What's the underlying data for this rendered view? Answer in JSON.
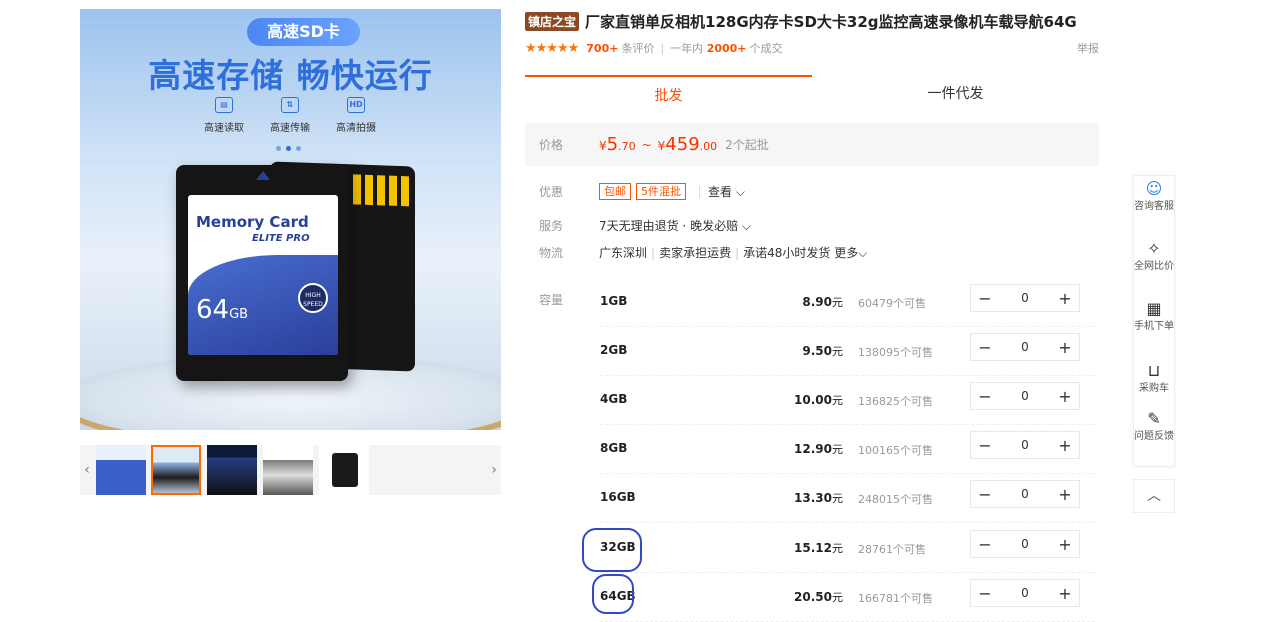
{
  "gallery": {
    "badge": "高速SD卡",
    "headline": "高速存储 畅快运行",
    "features": [
      {
        "icon": "sd-icon",
        "glyph": "▤",
        "label": "高速读取"
      },
      {
        "icon": "transfer-icon",
        "glyph": "⇅",
        "label": "高速传输"
      },
      {
        "icon": "hd-icon",
        "glyph": "HD",
        "label": "高清拍摄"
      }
    ],
    "card": {
      "brand": "Memory Card",
      "sub": "ELITE PRO",
      "capacity": "64",
      "unit": "GB",
      "speed": "HIGH SPEED"
    },
    "thumb_prev": "‹",
    "thumb_next": "›"
  },
  "product": {
    "shop_tag": "镇店之宝",
    "title": "厂家直销单反相机128G内存卡SD大卡32g监控高速录像机车载导航64G",
    "stars": "★★★★★",
    "reviews_count": "700+",
    "reviews_label": "条评价",
    "year_label": "一年内",
    "sold_count": "2000+",
    "sold_label": "个成交",
    "report": "举报"
  },
  "tabs": {
    "wholesale": "批发",
    "dropship": "一件代发"
  },
  "price": {
    "label": "价格",
    "currency": "¥",
    "low_int": "5",
    "low_dec": ".70",
    "sep": "~",
    "high_int": "459",
    "high_dec": ".00",
    "moq": "2个起批"
  },
  "offers": {
    "label": "优惠",
    "pills": [
      "包邮",
      "5件混批"
    ],
    "view": "查看 ⌵"
  },
  "service": {
    "label": "服务",
    "text": "7天无理由退货 · 晚发必赔 ⌵"
  },
  "logistics": {
    "label": "物流",
    "origin": "广东深圳",
    "freight": "卖家承担运费",
    "ship": "承诺48小时发货",
    "more": "更多⌵"
  },
  "capacity_label": "容量",
  "skus": [
    {
      "name": "1GB",
      "price": "8.90",
      "unit": "元",
      "stock": "60479个可售",
      "qty": "0"
    },
    {
      "name": "2GB",
      "price": "9.50",
      "unit": "元",
      "stock": "138095个可售",
      "qty": "0"
    },
    {
      "name": "4GB",
      "price": "10.00",
      "unit": "元",
      "stock": "136825个可售",
      "qty": "0"
    },
    {
      "name": "8GB",
      "price": "12.90",
      "unit": "元",
      "stock": "100165个可售",
      "qty": "0"
    },
    {
      "name": "16GB",
      "price": "13.30",
      "unit": "元",
      "stock": "248015个可售",
      "qty": "0"
    },
    {
      "name": "32GB",
      "price": "15.12",
      "unit": "元",
      "stock": "28761个可售",
      "qty": "0"
    },
    {
      "name": "64GB",
      "price": "20.50",
      "unit": "元",
      "stock": "166781个可售",
      "qty": "0"
    }
  ],
  "stepper": {
    "minus": "−",
    "plus": "+"
  },
  "sidebar": {
    "consult": "咨询客服",
    "compare": "全网比价",
    "mobile": "手机下单",
    "cart": "采购车",
    "feedback": "问题反馈",
    "to_top": "︿"
  },
  "colors": {
    "accent": "#ff5000",
    "price": "#ff2f00",
    "annotation": "#3349c0"
  }
}
